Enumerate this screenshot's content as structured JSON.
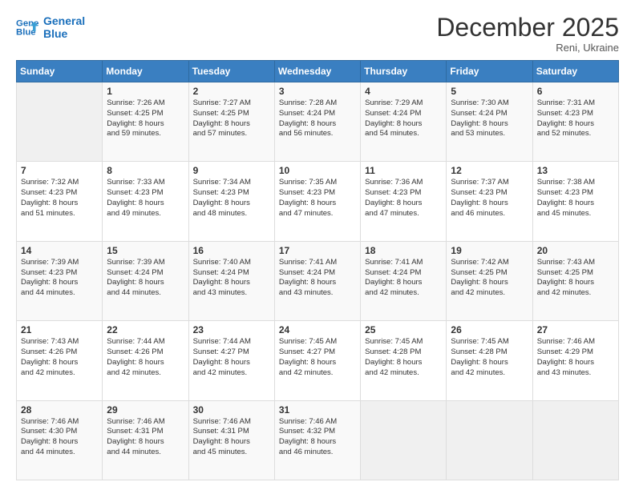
{
  "header": {
    "logo_line1": "General",
    "logo_line2": "Blue",
    "month": "December 2025",
    "location": "Reni, Ukraine"
  },
  "weekdays": [
    "Sunday",
    "Monday",
    "Tuesday",
    "Wednesday",
    "Thursday",
    "Friday",
    "Saturday"
  ],
  "weeks": [
    [
      {
        "day": "",
        "text": ""
      },
      {
        "day": "1",
        "text": "Sunrise: 7:26 AM\nSunset: 4:25 PM\nDaylight: 8 hours\nand 59 minutes."
      },
      {
        "day": "2",
        "text": "Sunrise: 7:27 AM\nSunset: 4:25 PM\nDaylight: 8 hours\nand 57 minutes."
      },
      {
        "day": "3",
        "text": "Sunrise: 7:28 AM\nSunset: 4:24 PM\nDaylight: 8 hours\nand 56 minutes."
      },
      {
        "day": "4",
        "text": "Sunrise: 7:29 AM\nSunset: 4:24 PM\nDaylight: 8 hours\nand 54 minutes."
      },
      {
        "day": "5",
        "text": "Sunrise: 7:30 AM\nSunset: 4:24 PM\nDaylight: 8 hours\nand 53 minutes."
      },
      {
        "day": "6",
        "text": "Sunrise: 7:31 AM\nSunset: 4:23 PM\nDaylight: 8 hours\nand 52 minutes."
      }
    ],
    [
      {
        "day": "7",
        "text": "Sunrise: 7:32 AM\nSunset: 4:23 PM\nDaylight: 8 hours\nand 51 minutes."
      },
      {
        "day": "8",
        "text": "Sunrise: 7:33 AM\nSunset: 4:23 PM\nDaylight: 8 hours\nand 49 minutes."
      },
      {
        "day": "9",
        "text": "Sunrise: 7:34 AM\nSunset: 4:23 PM\nDaylight: 8 hours\nand 48 minutes."
      },
      {
        "day": "10",
        "text": "Sunrise: 7:35 AM\nSunset: 4:23 PM\nDaylight: 8 hours\nand 47 minutes."
      },
      {
        "day": "11",
        "text": "Sunrise: 7:36 AM\nSunset: 4:23 PM\nDaylight: 8 hours\nand 47 minutes."
      },
      {
        "day": "12",
        "text": "Sunrise: 7:37 AM\nSunset: 4:23 PM\nDaylight: 8 hours\nand 46 minutes."
      },
      {
        "day": "13",
        "text": "Sunrise: 7:38 AM\nSunset: 4:23 PM\nDaylight: 8 hours\nand 45 minutes."
      }
    ],
    [
      {
        "day": "14",
        "text": "Sunrise: 7:39 AM\nSunset: 4:23 PM\nDaylight: 8 hours\nand 44 minutes."
      },
      {
        "day": "15",
        "text": "Sunrise: 7:39 AM\nSunset: 4:24 PM\nDaylight: 8 hours\nand 44 minutes."
      },
      {
        "day": "16",
        "text": "Sunrise: 7:40 AM\nSunset: 4:24 PM\nDaylight: 8 hours\nand 43 minutes."
      },
      {
        "day": "17",
        "text": "Sunrise: 7:41 AM\nSunset: 4:24 PM\nDaylight: 8 hours\nand 43 minutes."
      },
      {
        "day": "18",
        "text": "Sunrise: 7:41 AM\nSunset: 4:24 PM\nDaylight: 8 hours\nand 42 minutes."
      },
      {
        "day": "19",
        "text": "Sunrise: 7:42 AM\nSunset: 4:25 PM\nDaylight: 8 hours\nand 42 minutes."
      },
      {
        "day": "20",
        "text": "Sunrise: 7:43 AM\nSunset: 4:25 PM\nDaylight: 8 hours\nand 42 minutes."
      }
    ],
    [
      {
        "day": "21",
        "text": "Sunrise: 7:43 AM\nSunset: 4:26 PM\nDaylight: 8 hours\nand 42 minutes."
      },
      {
        "day": "22",
        "text": "Sunrise: 7:44 AM\nSunset: 4:26 PM\nDaylight: 8 hours\nand 42 minutes."
      },
      {
        "day": "23",
        "text": "Sunrise: 7:44 AM\nSunset: 4:27 PM\nDaylight: 8 hours\nand 42 minutes."
      },
      {
        "day": "24",
        "text": "Sunrise: 7:45 AM\nSunset: 4:27 PM\nDaylight: 8 hours\nand 42 minutes."
      },
      {
        "day": "25",
        "text": "Sunrise: 7:45 AM\nSunset: 4:28 PM\nDaylight: 8 hours\nand 42 minutes."
      },
      {
        "day": "26",
        "text": "Sunrise: 7:45 AM\nSunset: 4:28 PM\nDaylight: 8 hours\nand 42 minutes."
      },
      {
        "day": "27",
        "text": "Sunrise: 7:46 AM\nSunset: 4:29 PM\nDaylight: 8 hours\nand 43 minutes."
      }
    ],
    [
      {
        "day": "28",
        "text": "Sunrise: 7:46 AM\nSunset: 4:30 PM\nDaylight: 8 hours\nand 44 minutes."
      },
      {
        "day": "29",
        "text": "Sunrise: 7:46 AM\nSunset: 4:31 PM\nDaylight: 8 hours\nand 44 minutes."
      },
      {
        "day": "30",
        "text": "Sunrise: 7:46 AM\nSunset: 4:31 PM\nDaylight: 8 hours\nand 45 minutes."
      },
      {
        "day": "31",
        "text": "Sunrise: 7:46 AM\nSunset: 4:32 PM\nDaylight: 8 hours\nand 46 minutes."
      },
      {
        "day": "",
        "text": ""
      },
      {
        "day": "",
        "text": ""
      },
      {
        "day": "",
        "text": ""
      }
    ]
  ]
}
